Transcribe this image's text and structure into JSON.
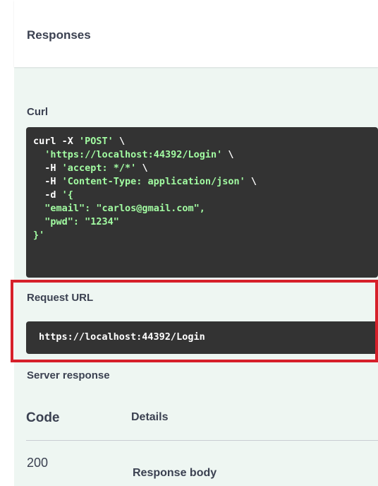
{
  "responses": {
    "title": "Responses"
  },
  "curl": {
    "label": "Curl",
    "lines": [
      {
        "plain": "curl -X ",
        "str": "'POST'",
        "tail": " \\"
      },
      {
        "plain": "  ",
        "str": "'https://localhost:44392/Login'",
        "tail": " \\"
      },
      {
        "plain": "  -H ",
        "str": "'accept: */*'",
        "tail": " \\"
      },
      {
        "plain": "  -H ",
        "str": "'Content-Type: application/json'",
        "tail": " \\"
      },
      {
        "plain": "  -d ",
        "str": "'{",
        "tail": ""
      },
      {
        "plain": "  ",
        "str": "\"email\": \"carlos@gmail.com\",",
        "tail": ""
      },
      {
        "plain": "  ",
        "str": "\"pwd\": \"1234\"",
        "tail": ""
      },
      {
        "plain": "",
        "str": "}'",
        "tail": ""
      }
    ]
  },
  "request_url": {
    "label": "Request URL",
    "value": "https://localhost:44392/Login"
  },
  "server_response": {
    "label": "Server response",
    "code_header": "Code",
    "details_header": "Details",
    "code": "200",
    "response_body_label": "Response body"
  },
  "colors": {
    "panel_bg": "#eef6f2",
    "code_bg": "#333333",
    "string_green": "#a2fca2",
    "highlight_red": "#d6202a"
  }
}
